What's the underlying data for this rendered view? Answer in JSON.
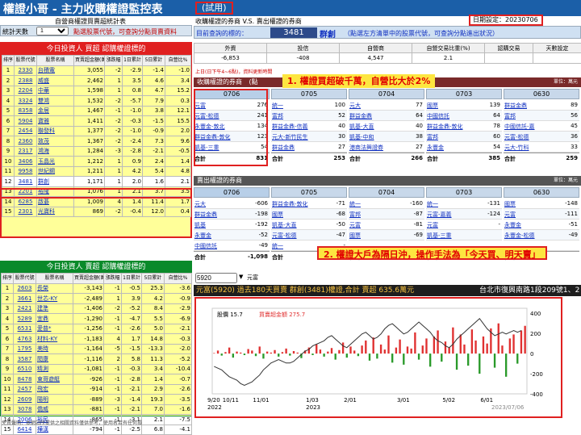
{
  "header": {
    "title": "權證小哥 - 主力收購權證監控表",
    "badge": "(試用)"
  },
  "left": {
    "subtitle": "自營商權證買賣超統計表",
    "days_label": "統計天數",
    "days_value": "1",
    "hint": "點選股票代號，可查詢分點買賣資料",
    "buy": {
      "title": "今日投資人 買超 認購權證標的",
      "headers": [
        "排序",
        "股票代號",
        "股票名稱",
        "買賣超金額(萬)",
        "漲跌幅",
        "1日累計",
        "5日累計",
        "自營比%"
      ],
      "rows": [
        [
          "1",
          "2330",
          "台積電",
          "3,055",
          "-2",
          "-2.9",
          "-1.4",
          "-1.0"
        ],
        [
          "2",
          "2388",
          "威盛",
          "2,462",
          "1",
          "3.5",
          "4.6",
          "3.4"
        ],
        [
          "3",
          "2204",
          "中華",
          "1,598",
          "1",
          "0.8",
          "4.7",
          "15.2"
        ],
        [
          "4",
          "3324",
          "雙鴻",
          "1,532",
          "-2",
          "-5.7",
          "7.9",
          "0.3"
        ],
        [
          "5",
          "8358",
          "金居",
          "1,467",
          "-1",
          "-1.0",
          "3.8",
          "12.1"
        ],
        [
          "6",
          "5904",
          "寶雅",
          "1,411",
          "-2",
          "-0.3",
          "-1.5",
          "15.5"
        ],
        [
          "7",
          "2454",
          "聯發科",
          "1,377",
          "-2",
          "-1.0",
          "-0.9",
          "2.0"
        ],
        [
          "8",
          "2360",
          "致茂",
          "1,367",
          "-2",
          "-2.4",
          "7.3",
          "9.6"
        ],
        [
          "9",
          "2317",
          "鴻海",
          "1,284",
          "-3",
          "-2.8",
          "-2.1",
          "-0.5"
        ],
        [
          "10",
          "3406",
          "玉晶光",
          "1,212",
          "1",
          "0.9",
          "2.4",
          "1.4"
        ],
        [
          "11",
          "9958",
          "世紀鋼",
          "1,211",
          "1",
          "4.2",
          "5.4",
          "4.8"
        ],
        [
          "12",
          "3481",
          "群創",
          "1,171",
          "1",
          "2.0",
          "1.6",
          "2.1"
        ],
        [
          "13",
          "2201",
          "裕隆",
          "1,076",
          "1",
          "2.1",
          "3.7",
          "3.5"
        ],
        [
          "14",
          "6285",
          "啟碁",
          "1,009",
          "4",
          "1.4",
          "11.4",
          "1.7"
        ],
        [
          "15",
          "2301",
          "光寶科",
          "869",
          "-2",
          "-0.4",
          "12.0",
          "0.4"
        ]
      ]
    },
    "sell": {
      "title": "今日投資人 賣超 認購權證標的",
      "headers": [
        "排序",
        "股票代號",
        "股票名稱",
        "買賣超金額(萬)",
        "漲跌幅",
        "1日累計",
        "5日累計",
        "自營比%"
      ],
      "rows": [
        [
          "1",
          "2603",
          "長榮",
          "-3,143",
          "-1",
          "-0.5",
          "25.3",
          "-3.6"
        ],
        [
          "2",
          "3661",
          "世芯-KY",
          "-2,489",
          "1",
          "3.9",
          "4.2",
          "-0.9"
        ],
        [
          "3",
          "2421",
          "建準",
          "-1,406",
          "-2",
          "-5.2",
          "8.4",
          "-2.9"
        ],
        [
          "4",
          "5289",
          "宜鼎",
          "-1,290",
          "-1",
          "-4.7",
          "5.5",
          "-6.9"
        ],
        [
          "5",
          "6531",
          "愛普*",
          "-1,256",
          "-1",
          "-2.6",
          "5.0",
          "-2.1"
        ],
        [
          "6",
          "4763",
          "材料-KY",
          "-1,183",
          "4",
          "1.7",
          "14.8",
          "-0.3"
        ],
        [
          "7",
          "1795",
          "美時",
          "-1,164",
          "-5",
          "-1.5",
          "-13.3",
          "-2.0"
        ],
        [
          "8",
          "3587",
          "閎康",
          "-1,116",
          "2",
          "5.8",
          "11.3",
          "-5.2"
        ],
        [
          "9",
          "6510",
          "精測",
          "-1,081",
          "-1",
          "-0.3",
          "3.4",
          "-10.4"
        ],
        [
          "10",
          "8478",
          "東哥遊艇",
          "-926",
          "-1",
          "-2.8",
          "1.4",
          "-0.7"
        ],
        [
          "11",
          "2457",
          "飛宏",
          "-914",
          "-1",
          "-2.1",
          "2.9",
          "-2.6"
        ],
        [
          "12",
          "2609",
          "陽明",
          "-889",
          "-3",
          "-1.4",
          "19.3",
          "-3.5"
        ],
        [
          "13",
          "3078",
          "僑威",
          "-881",
          "-1",
          "-2.1",
          "7.0",
          "-1.6"
        ],
        [
          "14",
          "2006",
          "裕民",
          "-865",
          "-1",
          "-3.1",
          "2.1",
          "-7.5"
        ],
        [
          "15",
          "6414",
          "樺漢",
          "-794",
          "-1",
          "-2.5",
          "6.8",
          "-4.1"
        ]
      ]
    },
    "footer": "免責聲明：本網站所提供之相關資料僅供參考，使用者若有任何損"
  },
  "right": {
    "title": "收購權證的券商 V.S. 賣出權證的券商",
    "date_label": "日期設定：",
    "date_value": "20230706",
    "target_label": "目前查詢的標的：",
    "target_code": "3481",
    "target_name": "群創",
    "target_hint": "（點選左方清單中的股票代號，可查詢分點進出狀況）",
    "summary": {
      "headers": [
        "外資",
        "投信",
        "自營商",
        "自營交易比重(%)",
        "認購交易",
        "天數設定"
      ],
      "values": [
        "-6,853",
        "-408",
        "4,547",
        "2.1",
        "",
        ""
      ]
    },
    "note": "上日(日下午4~6點)，資料更新時間",
    "buy_title": "收購權證的券商",
    "buy_suffix": "(點",
    "unit": "單位：萬元",
    "ann1": "1. 權證買超破千萬，自營比大於2%",
    "sell_title": "賣出權證的券商",
    "ann2": "2. 權證大戶為隔日沖，操作手法為「今天買、明天賣」",
    "sum_label": "合計",
    "cols": [
      {
        "date": "0706",
        "buy": [
          [
            "元富",
            "276"
          ],
          [
            "元富-松德",
            "241"
          ],
          [
            "永豐金-敦北",
            "134"
          ],
          [
            "群益金鼎-敦化",
            "123"
          ],
          [
            "凱基-三重",
            "54"
          ]
        ],
        "buy_total": "831",
        "sell": [
          [
            "元大",
            "-606"
          ],
          [
            "群益金鼎",
            "-198"
          ],
          [
            "凱基",
            "-192"
          ],
          [
            "永豐金",
            "-52"
          ],
          [
            "中國信託",
            "-49"
          ]
        ],
        "sell_total": "-1,098"
      },
      {
        "date": "0705",
        "buy": [
          [
            "統一",
            "100"
          ],
          [
            "富邦",
            "52"
          ],
          [
            "群益金鼎-信義",
            "40"
          ],
          [
            "元大-新竹民生",
            "30"
          ],
          [
            "群益金鼎",
            "27"
          ]
        ],
        "buy_total": "253",
        "sell": [
          [
            "群益金鼎-敦化",
            "-71"
          ],
          [
            "國票",
            "-68"
          ],
          [
            "凱基-大直",
            "-50"
          ],
          [
            "元富-松德",
            "-47"
          ],
          [
            "統一",
            "-",
            ""
          ]
        ],
        "sell_total": ""
      },
      {
        "date": "0704",
        "buy": [
          [
            "元大",
            "77"
          ],
          [
            "群益金鼎",
            "64"
          ],
          [
            "凱基-大直",
            "40"
          ],
          [
            "凱基-中和",
            "38"
          ],
          [
            "港商法興證券",
            "27"
          ]
        ],
        "buy_total": "266",
        "sell": [
          [
            "統一",
            "-160"
          ],
          [
            "富邦",
            "-87"
          ],
          [
            "元富",
            "-81"
          ],
          [
            "國票",
            "-69"
          ],
          [
            "",
            "",
            ""
          ]
        ],
        "sell_total": ""
      },
      {
        "date": "0703",
        "buy": [
          [
            "國票",
            "139"
          ],
          [
            "中國信託",
            "64"
          ],
          [
            "群益金鼎-敦化",
            "78"
          ],
          [
            "富邦",
            "60"
          ],
          [
            "永豐金",
            "54"
          ]
        ],
        "buy_total": "385",
        "sell": [
          [
            "統一",
            "-131"
          ],
          [
            "元富-嘉義",
            "-124"
          ],
          [
            "元富",
            "-",
            ""
          ],
          [
            "凱基-三重",
            "",
            ""
          ],
          [
            "",
            "",
            ""
          ]
        ],
        "sell_total": ""
      },
      {
        "date": "0630",
        "buy": [
          [
            "群益金鼎",
            "89"
          ],
          [
            "富邦",
            "56"
          ],
          [
            "中國信託-嘉",
            "45"
          ],
          [
            "元富-松德",
            "36"
          ],
          [
            "元大-竹科",
            "33"
          ]
        ],
        "buy_total": "259",
        "sell": [
          [
            "國票",
            "-148"
          ],
          [
            "元富",
            "-111"
          ],
          [
            "永豐金",
            "-51"
          ],
          [
            "永豐金-松德",
            "-49"
          ],
          [
            "",
            "",
            ""
          ]
        ],
        "sell_total": ""
      }
    ],
    "chart": {
      "code_input": "5920",
      "broker": "元富",
      "header": "元富(5920) 過去180天買賣 群創(3481)權證,合計 賣超 635.6萬元",
      "address": "台北市復興南路1段209號1、2",
      "legend_price": "股價 15.7",
      "legend_net": "買賣超金額 275.7",
      "date_stamp": "2023/07/06"
    }
  },
  "chart_data": {
    "type": "bar",
    "x_ticks": [
      "9/20",
      "10/11",
      "11/01",
      "1/03",
      "2/01",
      "3/01",
      "5/02",
      "6/01"
    ],
    "x_years": [
      "2022",
      "",
      "",
      "2023"
    ],
    "y_right_ticks": [
      "400",
      "200",
      "0",
      "-200",
      "-400"
    ],
    "ylim": [
      -400,
      450
    ],
    "series": [
      {
        "name": "買賣超金額",
        "values": [
          5,
          30,
          -20,
          15,
          60,
          -40,
          20,
          10,
          -15,
          45,
          30,
          -25,
          70,
          -50,
          20,
          10,
          35,
          -30,
          15,
          50,
          -20,
          25,
          10,
          -45,
          30,
          60,
          -15,
          90,
          40,
          -30,
          20,
          55,
          -60,
          35,
          110,
          -40,
          70,
          30,
          -25,
          80,
          130,
          -70,
          160,
          -50,
          90,
          40,
          180,
          -90,
          60,
          140,
          -110,
          70,
          50,
          210,
          -60,
          80,
          150,
          -130,
          170,
          230,
          -80,
          120,
          60,
          260,
          -160,
          190,
          90,
          -120,
          240,
          130,
          -200,
          170,
          100,
          250,
          -140,
          300,
          80,
          -230,
          150,
          190,
          -100,
          230,
          275.7
        ]
      },
      {
        "name": "股價",
        "values": [
          13.6,
          13.5,
          13.4,
          13.2,
          13.0,
          12.9,
          12.8,
          12.6,
          12.5,
          12.6,
          12.7,
          12.9,
          13.1,
          13.4,
          13.6,
          13.8,
          13.9,
          14.0,
          13.9,
          13.8,
          13.8,
          13.9,
          14.1,
          14.3,
          14.5,
          14.6,
          14.8,
          14.9,
          15.0,
          15.1,
          15.3,
          15.4,
          15.2,
          15.0,
          14.8,
          14.7,
          14.9,
          15.1,
          15.3,
          15.5,
          15.6,
          15.4,
          15.2,
          15.3,
          15.5,
          15.8,
          16.0,
          16.1,
          15.9,
          15.7,
          15.5,
          15.6,
          15.8,
          16.0,
          16.2,
          16.0,
          15.8,
          15.6,
          15.3,
          15.1,
          15.0,
          14.8,
          14.7,
          14.9,
          15.2,
          15.4,
          15.6,
          15.8,
          16.0,
          16.2,
          16.4,
          16.1,
          15.8,
          15.6,
          15.4,
          15.5,
          15.6,
          15.5,
          15.6,
          15.7,
          15.6,
          15.7
        ]
      }
    ]
  }
}
